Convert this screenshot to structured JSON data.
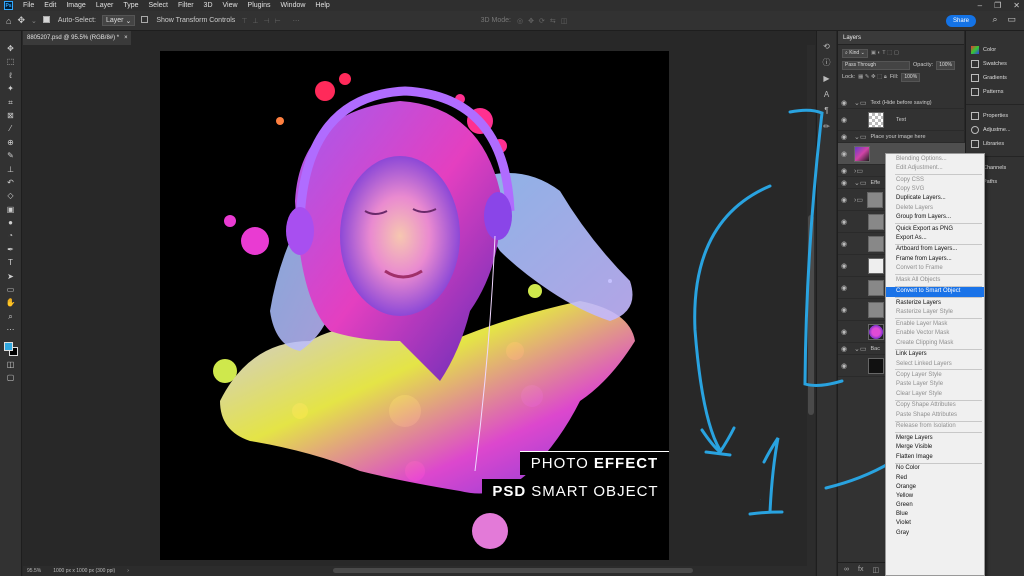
{
  "menubar": {
    "logo": "Ps",
    "items": [
      "File",
      "Edit",
      "Image",
      "Layer",
      "Type",
      "Select",
      "Filter",
      "3D",
      "View",
      "Plugins",
      "Window",
      "Help"
    ],
    "window_controls": [
      "–",
      "❐",
      "✕"
    ]
  },
  "options": {
    "auto_select_label": "Auto-Select:",
    "auto_select_value": "Layer",
    "transform_label": "Show Transform Controls",
    "mode_3d": "3D Mode:",
    "share": "Share"
  },
  "document": {
    "tab_title": "8805207.psd @ 95.5% (RGB/8#) *",
    "tab_close": "×",
    "zoom": "95.5%",
    "info": "1000 px x 1000 px (300 ppi)",
    "overlay_line1_light": "PHOTO",
    "overlay_line1_bold": "EFFECT",
    "overlay_line2_bold": "PSD",
    "overlay_line2_light": "SMART OBJECT"
  },
  "layers_panel": {
    "tab": "Layers",
    "kind": "Kind",
    "blend_mode": "Pass Through",
    "opacity_label": "Opacity:",
    "opacity_value": "100%",
    "lock_label": "Lock:",
    "fill_label": "Fill:",
    "fill_value": "100%",
    "layers": [
      {
        "name": "Text (Hide before saving)",
        "type": "group"
      },
      {
        "name": "Text",
        "type": "layer"
      },
      {
        "name": "Place your image here",
        "type": "group"
      },
      {
        "name": "",
        "type": "selected-photo"
      },
      {
        "name": "",
        "type": "group"
      },
      {
        "name": "Effe",
        "type": "group"
      },
      {
        "name": "",
        "type": "layer"
      },
      {
        "name": "",
        "type": "layer"
      },
      {
        "name": "",
        "type": "layer"
      },
      {
        "name": "",
        "type": "layer"
      },
      {
        "name": "",
        "type": "layer"
      },
      {
        "name": "",
        "type": "layer"
      },
      {
        "name": "",
        "type": "layer"
      },
      {
        "name": "Bac",
        "type": "group"
      },
      {
        "name": "",
        "type": "layer"
      }
    ]
  },
  "right_panels": {
    "group1": [
      "Color",
      "Swatches",
      "Gradients",
      "Patterns"
    ],
    "group2": [
      "Properties",
      "Adjustme...",
      "Libraries"
    ],
    "group3": [
      "Channels",
      "Paths"
    ]
  },
  "context_menu": {
    "items": [
      {
        "label": "Blending Options...",
        "disabled": true
      },
      {
        "label": "Edit Adjustment...",
        "disabled": true
      },
      {
        "sep": true
      },
      {
        "label": "Copy CSS",
        "disabled": true
      },
      {
        "label": "Copy SVG",
        "disabled": true
      },
      {
        "label": "Duplicate Layers...",
        "disabled": false
      },
      {
        "label": "Delete Layers",
        "disabled": true
      },
      {
        "label": "Group from Layers...",
        "disabled": false
      },
      {
        "sep": true
      },
      {
        "label": "Quick Export as PNG",
        "disabled": false
      },
      {
        "label": "Export As...",
        "disabled": false
      },
      {
        "sep": true
      },
      {
        "label": "Artboard from Layers...",
        "disabled": false
      },
      {
        "label": "Frame from Layers...",
        "disabled": false
      },
      {
        "label": "Convert to Frame",
        "disabled": true
      },
      {
        "sep": true
      },
      {
        "label": "Mask All Objects",
        "disabled": true
      },
      {
        "sep": true
      },
      {
        "label": "Convert to Smart Object",
        "disabled": false,
        "highlight": true
      },
      {
        "sep": true
      },
      {
        "label": "Rasterize Layers",
        "disabled": false
      },
      {
        "label": "Rasterize Layer Style",
        "disabled": true
      },
      {
        "sep": true
      },
      {
        "label": "Enable Layer Mask",
        "disabled": true
      },
      {
        "label": "Enable Vector Mask",
        "disabled": true
      },
      {
        "label": "Create Clipping Mask",
        "disabled": true
      },
      {
        "sep": true
      },
      {
        "label": "Link Layers",
        "disabled": false
      },
      {
        "label": "Select Linked Layers",
        "disabled": true
      },
      {
        "sep": true
      },
      {
        "label": "Copy Layer Style",
        "disabled": true
      },
      {
        "label": "Paste Layer Style",
        "disabled": true
      },
      {
        "label": "Clear Layer Style",
        "disabled": true
      },
      {
        "sep": true
      },
      {
        "label": "Copy Shape Attributes",
        "disabled": true
      },
      {
        "label": "Paste Shape Attributes",
        "disabled": true
      },
      {
        "sep": true
      },
      {
        "label": "Release from Isolation",
        "disabled": true
      },
      {
        "sep": true
      },
      {
        "label": "Merge Layers",
        "disabled": false
      },
      {
        "label": "Merge Visible",
        "disabled": false
      },
      {
        "label": "Flatten Image",
        "disabled": false
      },
      {
        "sep": true
      },
      {
        "label": "No Color",
        "disabled": false
      },
      {
        "label": "Red",
        "disabled": false
      },
      {
        "label": "Orange",
        "disabled": false
      },
      {
        "label": "Yellow",
        "disabled": false
      },
      {
        "label": "Green",
        "disabled": false
      },
      {
        "label": "Blue",
        "disabled": false
      },
      {
        "label": "Violet",
        "disabled": false
      },
      {
        "label": "Gray",
        "disabled": false
      }
    ]
  },
  "annotation": {
    "number": "1",
    "color": "#29a3e0"
  },
  "colors": {
    "accent": "#1473e6",
    "highlight": "#1a73e8",
    "foreground": "#31a8e0",
    "background": "#000000"
  }
}
